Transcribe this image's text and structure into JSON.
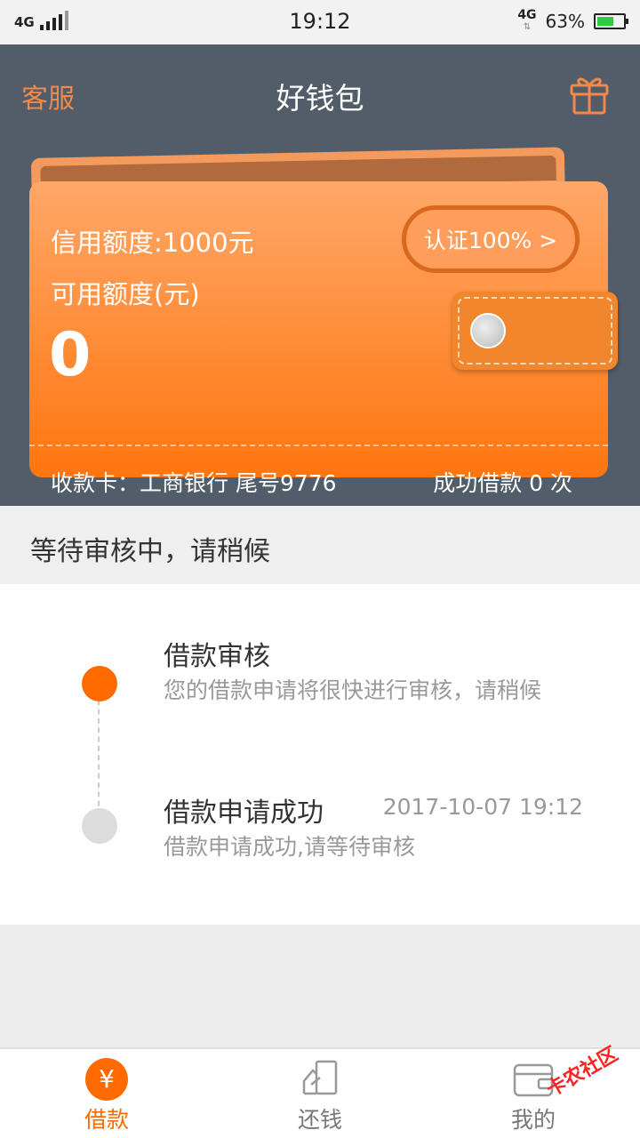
{
  "status_bar": {
    "network_left": "4G",
    "time": "19:12",
    "network_right": "4G",
    "battery": "63%",
    "battery_level": 0.63
  },
  "header": {
    "customer_service": "客服",
    "title": "好钱包"
  },
  "card": {
    "credit_limit": "信用额度:1000元",
    "auth_button": "认证100% >",
    "available_label": "可用额度(元)",
    "available_value": "0",
    "bank_info": "收款卡：工商银行 尾号9776",
    "loan_count": "成功借款 0 次"
  },
  "status_message": "等待审核中，请稍候",
  "timeline": [
    {
      "title": "借款审核",
      "desc": "您的借款申请将很快进行审核，请稍候",
      "time": ""
    },
    {
      "title": "借款申请成功",
      "desc": "借款申请成功,请等待审核",
      "time": "2017-10-07 19:12"
    }
  ],
  "tabs": [
    {
      "label": "借款",
      "icon": "yuan-icon"
    },
    {
      "label": "还钱",
      "icon": "repay-icon"
    },
    {
      "label": "我的",
      "icon": "wallet-icon"
    }
  ],
  "watermark": "卡农社区",
  "colors": {
    "accent": "#ff6b00",
    "header_bg": "#535d69",
    "accent_soft": "#f0894a"
  }
}
